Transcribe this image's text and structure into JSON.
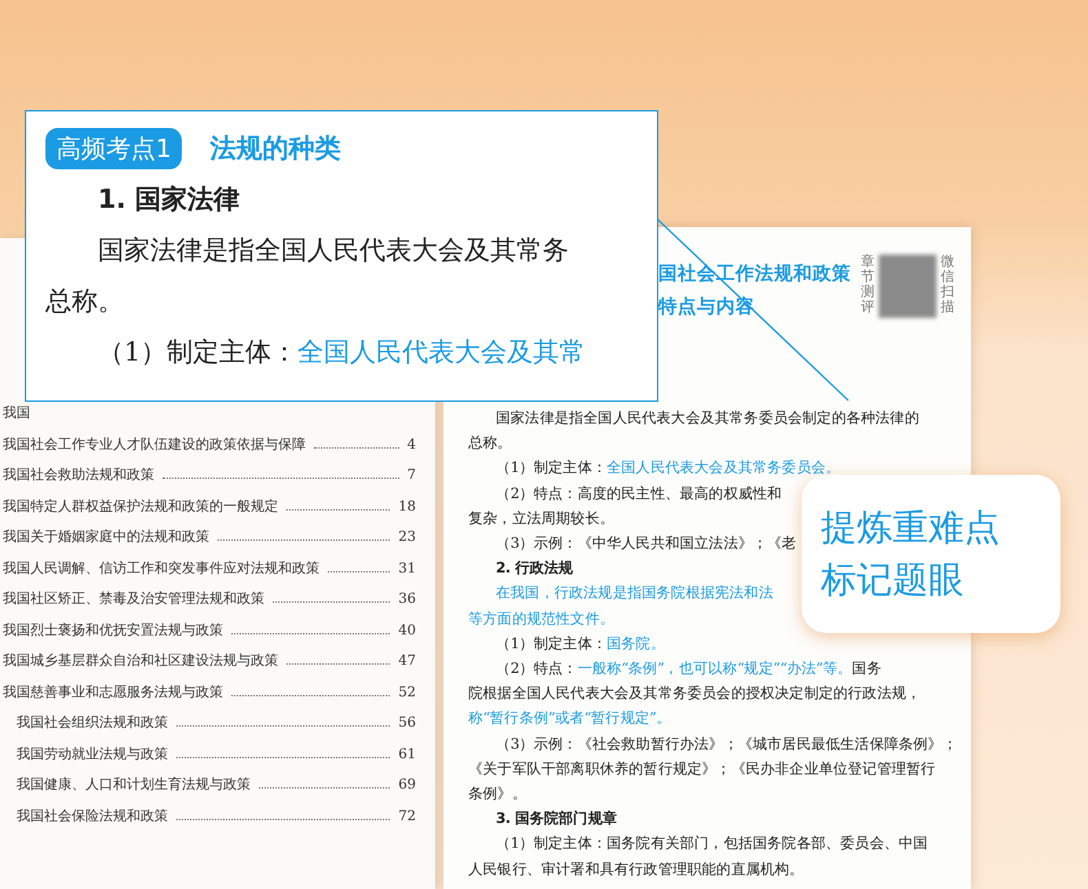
{
  "magnifier": {
    "badge": "高频考点1",
    "title": "法规的种类",
    "lines": [
      {
        "kind": "heading",
        "indent": true,
        "segments": [
          {
            "text": "1.  国家法律",
            "highlight": false
          }
        ]
      },
      {
        "kind": "text",
        "indent": true,
        "segments": [
          {
            "text": "国家法律是指全国人民代表大会及其常务",
            "highlight": false
          }
        ]
      },
      {
        "kind": "text",
        "indent": false,
        "segments": [
          {
            "text": "总称。",
            "highlight": false
          }
        ]
      },
      {
        "kind": "text",
        "indent": true,
        "segments": [
          {
            "text": "（1）制定主体：",
            "highlight": false
          },
          {
            "text": "全国人民代表大会及其常",
            "highlight": true
          }
        ]
      }
    ]
  },
  "toc": {
    "items": [
      {
        "kind": "main",
        "title": "我国"
      },
      {
        "kind": "main",
        "title": "我国社会工作专业人才队伍建设的政策依据与保障",
        "page": "4"
      },
      {
        "kind": "main",
        "title": "我国社会救助法规和政策",
        "page": "7"
      },
      {
        "kind": "main",
        "title": "我国特定人群权益保护法规和政策的一般规定",
        "page": "18"
      },
      {
        "kind": "main",
        "title": "我国关于婚姻家庭中的法规和政策",
        "page": "23"
      },
      {
        "kind": "main",
        "title": "我国人民调解、信访工作和突发事件应对法规和政策",
        "page": "31"
      },
      {
        "kind": "main",
        "title": "我国社区矫正、禁毒及治安管理法规和政策",
        "page": "36"
      },
      {
        "kind": "main",
        "title": "我国烈士褒扬和优抚安置法规与政策",
        "page": "40"
      },
      {
        "kind": "main",
        "title": "我国城乡基层群众自治和社区建设法规与政策",
        "page": "47"
      },
      {
        "kind": "main",
        "title": "我国慈善事业和志愿服务法规与政策",
        "page": "52"
      },
      {
        "kind": "sub",
        "title": "我国社会组织法规和政策",
        "page": "56"
      },
      {
        "kind": "sub",
        "title": "我国劳动就业法规与政策",
        "page": "61"
      },
      {
        "kind": "sub",
        "title": "我国健康、人口和计划生育法规与政策",
        "page": "69"
      },
      {
        "kind": "sub",
        "title": "我国社会保险法规和政策",
        "page": "72"
      }
    ]
  },
  "page": {
    "heading": [
      "国社会工作法规和政策",
      "特点与内容"
    ],
    "qr_caption_left": "章节测评",
    "qr_caption_right": "微信扫描",
    "lines": [
      {
        "kind": "text",
        "indent": true,
        "segments": [
          {
            "text": "国家法律是指全国人民代表大会及其常务委员会制定的各种法律的",
            "highlight": false
          }
        ]
      },
      {
        "kind": "text",
        "indent": false,
        "segments": [
          {
            "text": "总称。",
            "highlight": false
          }
        ]
      },
      {
        "kind": "text",
        "indent": true,
        "segments": [
          {
            "text": "（1）制定主体：",
            "highlight": false
          },
          {
            "text": "全国人民代表大会及其常务委员会。",
            "highlight": true
          }
        ]
      },
      {
        "kind": "text",
        "indent": true,
        "segments": [
          {
            "text": "（2）特点：高度的民主性、最高的权威性和",
            "highlight": false
          }
        ]
      },
      {
        "kind": "text",
        "indent": false,
        "segments": [
          {
            "text": "复杂，立法周期较长。",
            "highlight": false
          }
        ]
      },
      {
        "kind": "text",
        "indent": true,
        "segments": [
          {
            "text": "（3）示例：《中华人民共和国立法法》；《老",
            "highlight": false
          }
        ]
      },
      {
        "kind": "heading",
        "indent": true,
        "segments": [
          {
            "text": "2.  行政法规",
            "highlight": false
          }
        ]
      },
      {
        "kind": "text",
        "indent": true,
        "segments": [
          {
            "text": "在我国，行政法规是指国务院根据宪法和法",
            "highlight": true
          }
        ]
      },
      {
        "kind": "text",
        "indent": false,
        "segments": [
          {
            "text": "等方面的规范性文件。",
            "highlight": true
          }
        ]
      },
      {
        "kind": "text",
        "indent": true,
        "segments": [
          {
            "text": "（1）制定主体：",
            "highlight": false
          },
          {
            "text": "国务院。",
            "highlight": true
          }
        ]
      },
      {
        "kind": "text",
        "indent": true,
        "segments": [
          {
            "text": "（2）特点：",
            "highlight": false
          },
          {
            "text": "一般称“条例”，也可以称“规定”“办法”等。",
            "highlight": true
          },
          {
            "text": "国务",
            "highlight": false
          }
        ]
      },
      {
        "kind": "text",
        "indent": false,
        "segments": [
          {
            "text": "院根据全国人民代表大会及其常务委员会的授权决定制定的行政法规，",
            "highlight": false
          }
        ]
      },
      {
        "kind": "text",
        "indent": false,
        "segments": [
          {
            "text": "称“暂行条例”或者“暂行规定”。",
            "highlight": true
          }
        ]
      },
      {
        "kind": "text",
        "indent": true,
        "segments": [
          {
            "text": "（3）示例：《社会救助暂行办法》；《城市居民最低生活保障条例》；",
            "highlight": false
          }
        ]
      },
      {
        "kind": "text",
        "indent": false,
        "segments": [
          {
            "text": "《关于军队干部离职休养的暂行规定》；《民办非企业单位登记管理暂行",
            "highlight": false
          }
        ]
      },
      {
        "kind": "text",
        "indent": false,
        "segments": [
          {
            "text": "条例》。",
            "highlight": false
          }
        ]
      },
      {
        "kind": "heading",
        "indent": true,
        "segments": [
          {
            "text": "3.  国务院部门规章",
            "highlight": false
          }
        ]
      },
      {
        "kind": "text",
        "indent": true,
        "segments": [
          {
            "text": "（1）制定主体：国务院有关部门，包括国务院各部、委员会、中国",
            "highlight": false
          }
        ]
      },
      {
        "kind": "text",
        "indent": false,
        "segments": [
          {
            "text": "人民银行、审计署和具有行政管理职能的直属机构。",
            "highlight": false
          }
        ]
      }
    ]
  },
  "bubble": {
    "lines": [
      "提炼重难点",
      "标记题眼"
    ]
  }
}
